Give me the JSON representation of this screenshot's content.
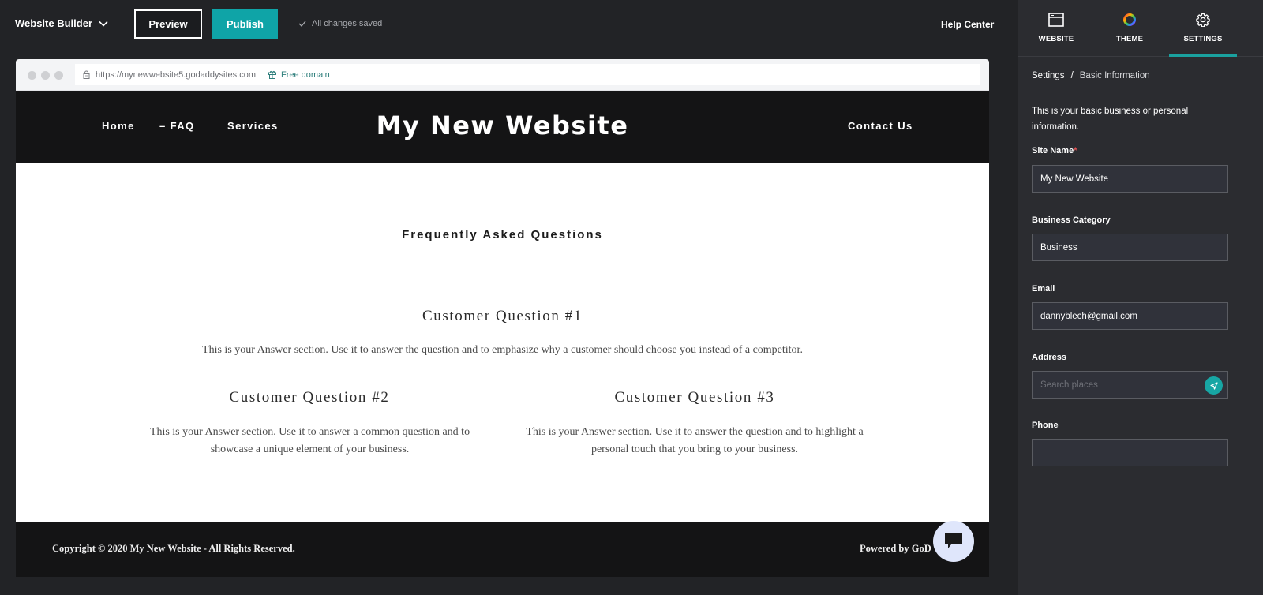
{
  "topbar": {
    "brand": "Website Builder",
    "preview_label": "Preview",
    "publish_label": "Publish",
    "save_status": "All changes saved",
    "help_label": "Help Center"
  },
  "browser": {
    "url": "https://mynewwebsite5.godaddysites.com",
    "domain_offer": "Free domain"
  },
  "site": {
    "title": "My New Website",
    "nav": {
      "home": "Home",
      "faq": "– FAQ",
      "services": "Services",
      "contact": "Contact Us"
    },
    "section_title": "Frequently Asked Questions",
    "questions": [
      {
        "title": "Customer Question #1",
        "answer": "This is your Answer section. Use it to answer the question and to  emphasize why a customer should choose you instead of a competitor."
      },
      {
        "title": "Customer Question #2",
        "answer": "This is your Answer section. Use it to answer a common question and to showcase a unique element of your business."
      },
      {
        "title": "Customer Question #3",
        "answer": "This is your Answer section. Use it to answer the question and to highlight a personal touch that you bring to your business."
      }
    ],
    "footer": {
      "copyright": "Copyright © 2020 My New Website - All Rights Reserved.",
      "powered_by": "Powered by GoD"
    }
  },
  "panel": {
    "tabs": [
      {
        "label": "WEBSITE",
        "icon": "browser-window-icon",
        "active": false
      },
      {
        "label": "THEME",
        "icon": "color-wheel-icon",
        "active": false
      },
      {
        "label": "SETTINGS",
        "icon": "gear-icon",
        "active": true
      }
    ],
    "breadcrumb": {
      "root": "Settings",
      "separator": "/",
      "current": "Basic Information"
    },
    "description": "This is your basic business or personal information.",
    "fields": {
      "site_name": {
        "label": "Site Name",
        "required_mark": "*",
        "value": "My New Website"
      },
      "business_category": {
        "label": "Business Category",
        "value": "Business"
      },
      "email": {
        "label": "Email",
        "value": "dannyblech@gmail.com"
      },
      "address": {
        "label": "Address",
        "value": "",
        "placeholder": "Search places"
      },
      "phone": {
        "label": "Phone",
        "value": ""
      }
    }
  },
  "colors": {
    "accent": "#0fa4a7",
    "app_bg": "#222326",
    "panel_bg": "#2b2c30",
    "site_dark": "#141415",
    "chat_bubble": "#dfe6fb",
    "required": "#e05252"
  }
}
